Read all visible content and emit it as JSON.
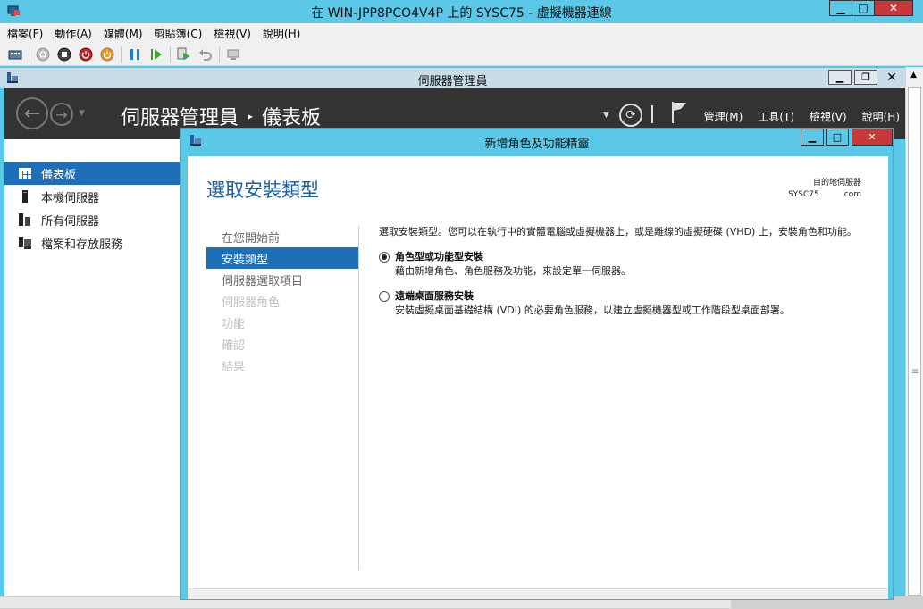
{
  "vm": {
    "title": "在 WIN-JPP8PCO4V4P 上的 SYSC75 - 虛擬機器連線",
    "menus": [
      "檔案(F)",
      "動作(A)",
      "媒體(M)",
      "剪貼簿(C)",
      "檢視(V)",
      "說明(H)"
    ],
    "window_buttons": {
      "minimize": "▁",
      "maximize": "□",
      "close": "✕"
    }
  },
  "server_manager": {
    "title": "伺服器管理員",
    "window_buttons": {
      "minimize": "▁",
      "restore": "❐",
      "close": "✕"
    },
    "breadcrumb": {
      "root": "伺服器管理員",
      "separator": "▸",
      "current": "儀表板"
    },
    "menus": [
      "管理(M)",
      "工具(T)",
      "檢視(V)",
      "說明(H)"
    ],
    "sidebar": [
      {
        "label": "儀表板",
        "icon": "dashboard-icon",
        "active": true
      },
      {
        "label": "本機伺服器",
        "icon": "local-server-icon",
        "active": false
      },
      {
        "label": "所有伺服器",
        "icon": "all-servers-icon",
        "active": false
      },
      {
        "label": "檔案和存放服務",
        "icon": "file-storage-icon",
        "active": false
      }
    ]
  },
  "wizard": {
    "title": "新增角色及功能精靈",
    "window_buttons": {
      "minimize": "▁",
      "maximize": "□",
      "close": "✕"
    },
    "heading": "選取安裝類型",
    "destination_label": "目的地伺服器",
    "destination_server": "SYSC75",
    "destination_domain": "com",
    "steps": [
      {
        "label": "在您開始前",
        "state": "normal"
      },
      {
        "label": "安裝類型",
        "state": "active"
      },
      {
        "label": "伺服器選取項目",
        "state": "normal"
      },
      {
        "label": "伺服器角色",
        "state": "disabled"
      },
      {
        "label": "功能",
        "state": "disabled"
      },
      {
        "label": "確認",
        "state": "disabled"
      },
      {
        "label": "結果",
        "state": "disabled"
      }
    ],
    "intro": "選取安裝類型。您可以在執行中的實體電腦或虛擬機器上，或是離線的虛擬硬碟 (VHD) 上，安裝角色和功能。",
    "options": [
      {
        "title": "角色型或功能型安裝",
        "desc": "藉由新增角色、角色服務及功能，來設定單一伺服器。",
        "checked": true
      },
      {
        "title": "遠端桌面服務安裝",
        "desc": "安裝虛擬桌面基礎結構 (VDI) 的必要角色服務，以建立虛擬機器型或工作階段型桌面部署。",
        "checked": false
      }
    ]
  },
  "colors": {
    "accent": "#1d6fb7",
    "title_bar": "#5bc8e8",
    "header_dark": "#333333",
    "heading_blue": "#1b5ea4"
  }
}
